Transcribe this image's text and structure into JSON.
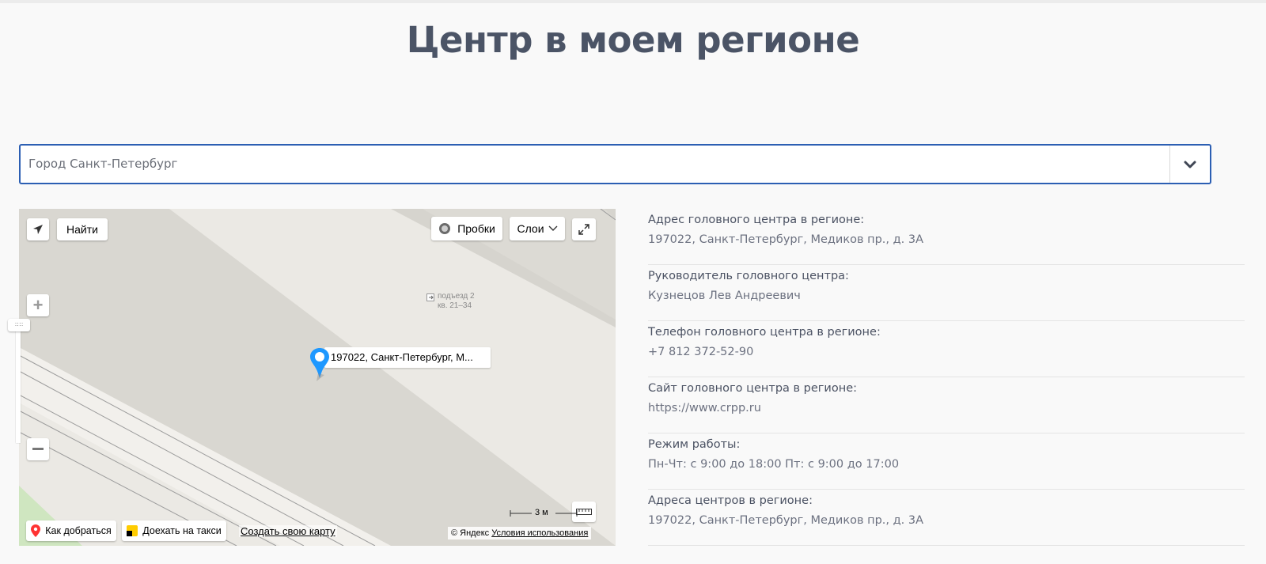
{
  "page": {
    "title": "Центр в моем регионе"
  },
  "region_select": {
    "value": "Город Санкт-Петербург"
  },
  "map": {
    "find_button": "Найти",
    "traffic_button": "Пробки",
    "layers_button": "Слои",
    "pin_label": "197022, Санкт-Петербург, М...",
    "entrance_label_1": "подъезд 2",
    "entrance_label_2": "кв. 21–34",
    "route_button": "Как добраться",
    "taxi_button": "Доехать на такси",
    "create_map_link": "Создать свою карту",
    "scale_label": "3 м",
    "copyright": "© Яндекс",
    "terms_link": "Условия использования"
  },
  "info": [
    {
      "label": "Адрес головного центра в регионе:",
      "value": "197022, Санкт-Петербург, Медиков пр., д. 3А"
    },
    {
      "label": "Руководитель головного центра:",
      "value": "Кузнецов Лев Андреевич"
    },
    {
      "label": "Телефон головного центра в регионе:",
      "value": "+7 812 372-52-90"
    },
    {
      "label": "Сайт головного центра в регионе:",
      "value": "https://www.crpp.ru"
    },
    {
      "label": "Режим работы:",
      "value": "Пн-Чт: с 9:00 до 18:00 Пт: с 9:00 до 17:00"
    },
    {
      "label": "Адреса центров в регионе:",
      "value": "197022, Санкт-Петербург, Медиков пр., д. 3А"
    }
  ],
  "colors": {
    "accent": "#2c5fb3",
    "title": "#4b5466",
    "pin": "#1e98ff"
  }
}
